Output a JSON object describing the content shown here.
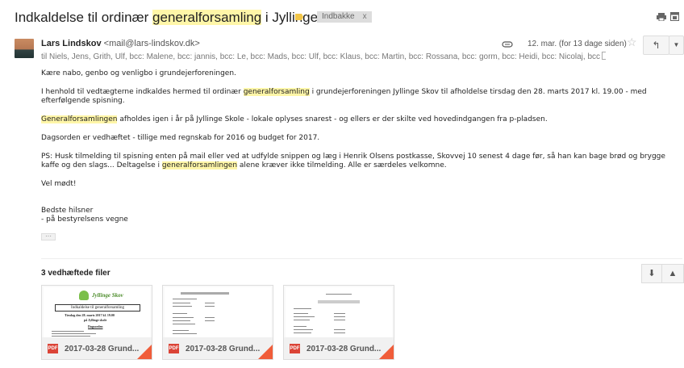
{
  "subject": {
    "before": "Indkaldelse til ordinær ",
    "highlight": "generalforsamling",
    "after": " i Jyllinge Skov",
    "label": "Indbakke",
    "label_close": "x"
  },
  "sender": {
    "name": "Lars Lindskov",
    "email": "<mail@lars-lindskov.dk>",
    "recipients": "til Niels, Jens, Grith, Ulf, bcc: Malene, bcc: jannis, bcc: Le, bcc: Mads, bcc: Ulf, bcc: Klaus, bcc: Martin, bcc: Rossana, bcc: gorm, bcc: Heidi, bcc: Nicolaj, bcc",
    "date": "12. mar. (for 13 dage siden)",
    "star": "☆",
    "reply": "↰",
    "more": "▼"
  },
  "body": {
    "p1": "Kære nabo, genbo og venligbo i grundejerforeningen.",
    "p2_before": "I henhold til vedtægterne indkaldes hermed til ordinær ",
    "p2_highlight": "generalforsamling",
    "p2_after": " i grundejerforeningen Jyllinge Skov til afholdelse tirsdag den 28. marts 2017 kl. 19.00 - med efterfølgende spisning.",
    "p3_highlight": "Generalforsamlingen",
    "p3_after": " afholdes igen i år på Jyllinge Skole - lokale oplyses snarest - og ellers er der skilte ved hovedindgangen fra p-pladsen.",
    "p4": "Dagsorden er vedhæftet - tillige med regnskab for 2016 og budget for 2017.",
    "p5_before": "PS: Husk tilmelding til spisning enten på mail eller ved at udfylde snippen og læg i Henrik Olsens postkasse, Skovvej 10 senest 4 dage før, så han kan bage brød og brygge kaffe og den slags... Deltagelse i ",
    "p5_highlight": "generalforsamlingen",
    "p5_after": " alene kræver ikke tilmelding. Alle er særdeles velkomne.",
    "p6": "Vel mødt!",
    "p7a": "Bedste hilsner",
    "p7b": "- på bestyrelsens vegne",
    "ellipsis": "···"
  },
  "attachments": {
    "title": "3 vedhæftede filer",
    "download_icon": "⬇",
    "drive_icon": "▲",
    "files": [
      {
        "name": "2017-03-28 Grund...",
        "type": "PDF",
        "thumb_heading": "Jyllinge Skov",
        "thumb_title": "Indkaldelse til generalforsamling",
        "thumb_date": "Tirsdag den 28. marts 2017 kl. 19.00",
        "thumb_place": "på Jyllinge skole",
        "thumb_section": "Dagsorden"
      },
      {
        "name": "2017-03-28 Grund...",
        "type": "PDF"
      },
      {
        "name": "2017-03-28 Grund...",
        "type": "PDF"
      }
    ]
  },
  "colors": {
    "highlight": "#fff6a8",
    "label_flag": "#f2c649",
    "pdf_red": "#db4437",
    "corner": "#f05d3a"
  }
}
